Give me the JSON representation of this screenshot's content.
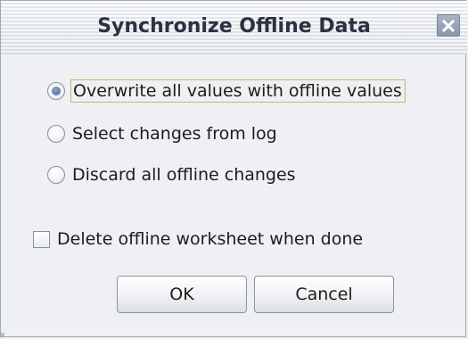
{
  "window": {
    "title": "Synchronize Offline Data",
    "close_icon": "close-icon"
  },
  "options": [
    {
      "label": "Overwrite all values with offline values",
      "selected": true
    },
    {
      "label": "Select changes from log",
      "selected": false
    },
    {
      "label": "Discard all offline changes",
      "selected": false
    }
  ],
  "checkbox": {
    "label": "Delete offline worksheet when done",
    "checked": false
  },
  "buttons": {
    "ok_label": "OK",
    "cancel_label": "Cancel"
  },
  "colors": {
    "window_bg": "#eef0f3",
    "title_text": "#2a3140",
    "close_button": "#8996ad",
    "radio_selected_dot": "#4e619a",
    "focus_border": "#c9b56a"
  }
}
